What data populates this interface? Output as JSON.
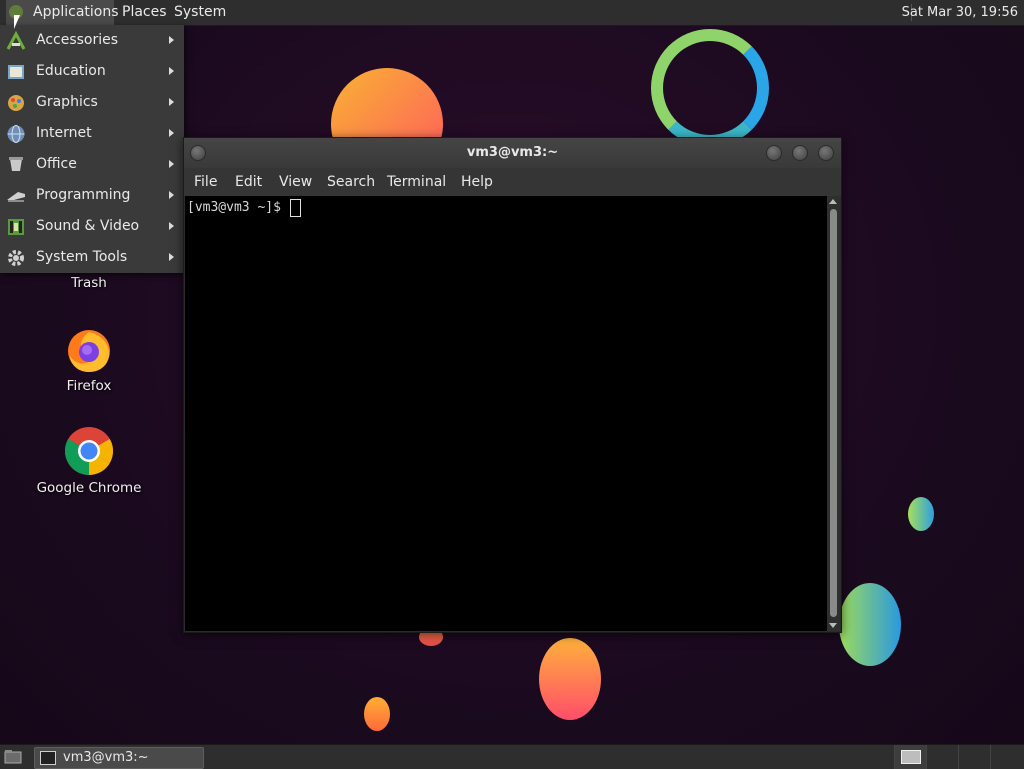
{
  "top_panel": {
    "applications_label": "Applications",
    "places_label": "Places",
    "system_label": "System",
    "clock": "Sat Mar 30, 19:56"
  },
  "applications_menu": {
    "items": [
      {
        "label": "Accessories",
        "icon": "accessories-icon"
      },
      {
        "label": "Education",
        "icon": "education-icon"
      },
      {
        "label": "Graphics",
        "icon": "graphics-icon"
      },
      {
        "label": "Internet",
        "icon": "internet-icon"
      },
      {
        "label": "Office",
        "icon": "office-icon"
      },
      {
        "label": "Programming",
        "icon": "programming-icon"
      },
      {
        "label": "Sound & Video",
        "icon": "sound-video-icon"
      },
      {
        "label": "System Tools",
        "icon": "system-tools-icon"
      }
    ]
  },
  "desktop": {
    "icons": [
      {
        "label": "Trash",
        "icon": "trash-icon"
      },
      {
        "label": "Firefox",
        "icon": "firefox-icon"
      },
      {
        "label": "Google Chrome",
        "icon": "chrome-icon"
      }
    ]
  },
  "terminal": {
    "title": "vm3@vm3:~",
    "menu": [
      "File",
      "Edit",
      "View",
      "Search",
      "Terminal",
      "Help"
    ],
    "prompt": "[vm3@vm3 ~]$"
  },
  "bottom_panel": {
    "task_label": "vm3@vm3:~"
  },
  "colors": {
    "panel_bg": "#2e2e2e",
    "menu_bg": "#3a3a3a",
    "terminal_bg": "#000000",
    "desktop_bg": "#1b0a1f"
  }
}
